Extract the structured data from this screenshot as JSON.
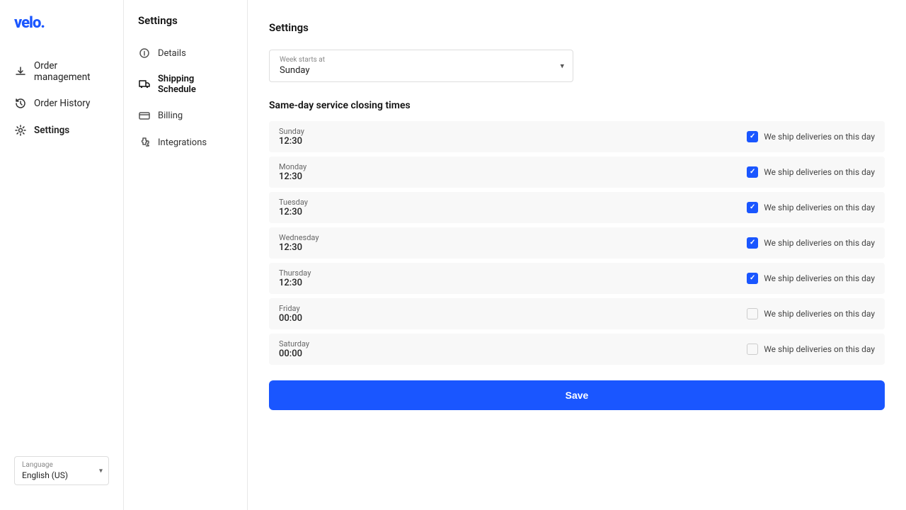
{
  "logo": {
    "text": "velo."
  },
  "sidebar": {
    "items": [
      {
        "label": "Order management",
        "icon": "download-icon"
      },
      {
        "label": "Order History",
        "icon": "history-icon"
      },
      {
        "label": "Settings",
        "icon": "gear-icon",
        "active": true
      }
    ]
  },
  "settings_nav": {
    "title": "Settings",
    "items": [
      {
        "label": "Details",
        "icon": "info-icon"
      },
      {
        "label": "Shipping Schedule",
        "icon": "truck-icon",
        "active": true
      },
      {
        "label": "Billing",
        "icon": "card-icon"
      },
      {
        "label": "Integrations",
        "icon": "puzzle-icon"
      }
    ]
  },
  "main": {
    "title": "Settings",
    "week_starts": {
      "label": "Week starts at",
      "value": "Sunday"
    },
    "same_day_title": "Same-day service closing times",
    "days": [
      {
        "name": "Sunday",
        "time": "12:30",
        "checked": true
      },
      {
        "name": "Monday",
        "time": "12:30",
        "checked": true
      },
      {
        "name": "Tuesday",
        "time": "12:30",
        "checked": true
      },
      {
        "name": "Wednesday",
        "time": "12:30",
        "checked": true
      },
      {
        "name": "Thursday",
        "time": "12:30",
        "checked": true
      },
      {
        "name": "Friday",
        "time": "00:00",
        "checked": false
      },
      {
        "name": "Saturday",
        "time": "00:00",
        "checked": false
      }
    ],
    "ship_label": "We ship deliveries on this day",
    "save_label": "Save"
  },
  "footer": {
    "language_label": "Language",
    "language_value": "English (US)"
  }
}
